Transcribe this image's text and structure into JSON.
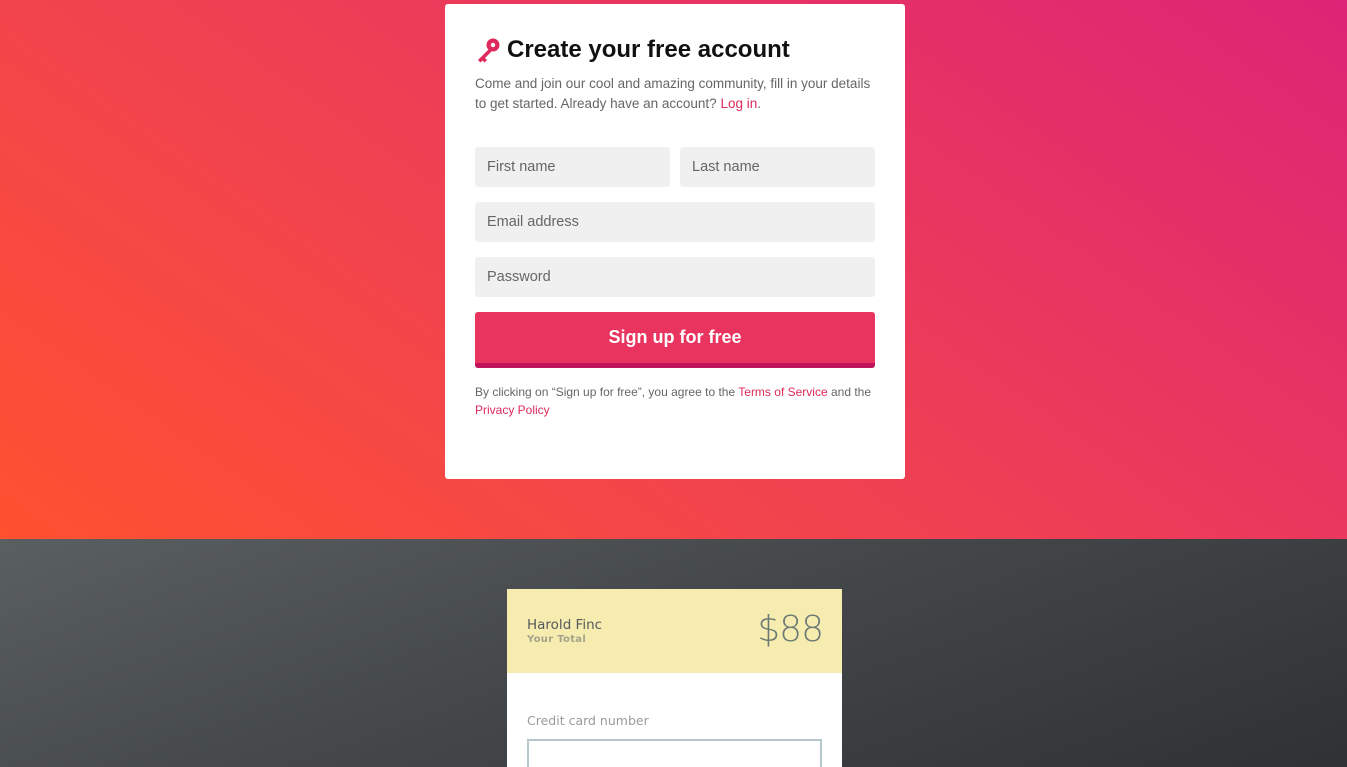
{
  "signup": {
    "title": "Create your free account",
    "description": "Come and join our cool and amazing community, fill in your details to get started. Already have an account?",
    "login_link": "Log in",
    "first_name_placeholder": "First name",
    "last_name_placeholder": "Last name",
    "email_placeholder": "Email address",
    "password_placeholder": "Password",
    "submit_label": "Sign up for free",
    "terms_prefix": "By clicking on “Sign up for free”, you agree to the",
    "terms_link": "Terms of Service",
    "terms_middle": "and the",
    "privacy_link": "Privacy Policy"
  },
  "payment": {
    "name": "Harold Finc",
    "total_label": "Your Total",
    "total_amount": "$88",
    "cc_label": "Credit card number",
    "cc_value": ""
  },
  "colors": {
    "accent": "#e8345e",
    "accent_dark": "#c0135c",
    "link": "#dd2a5a",
    "payment_header": "#f7ecb0"
  },
  "icons": {
    "title_icon": "key-icon"
  }
}
